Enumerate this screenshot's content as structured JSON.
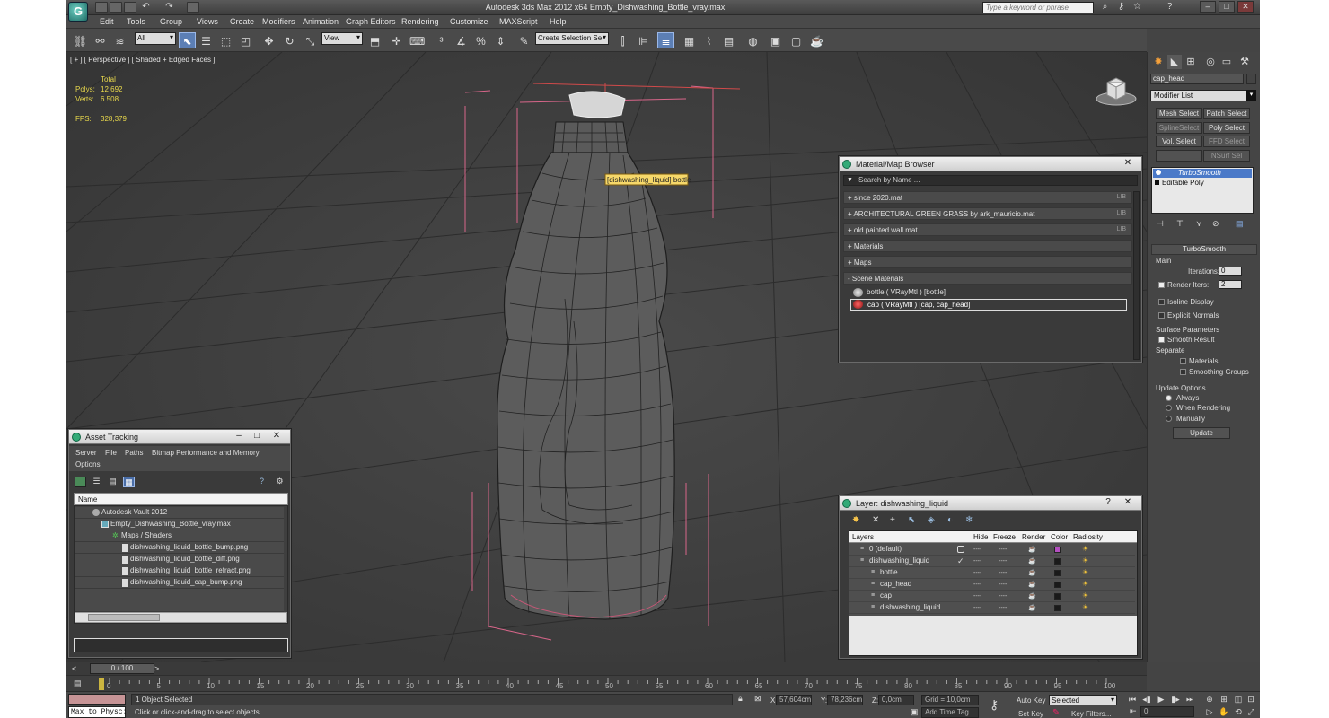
{
  "window": {
    "title": "Autodesk 3ds Max  2012 x64     Empty_Dishwashing_Bottle_vray.max",
    "search_placeholder": "Type a keyword or phrase",
    "app_letter": "G"
  },
  "menu": [
    "Edit",
    "Tools",
    "Group",
    "Views",
    "Create",
    "Modifiers",
    "Animation",
    "Graph Editors",
    "Rendering",
    "Customize",
    "MAXScript",
    "Help"
  ],
  "toolbar": {
    "filter": "All",
    "ref_coord": "View",
    "selection_set": "Create Selection Se"
  },
  "viewport": {
    "label": "[ + ] [ Perspective ] [ Shaded + Edged Faces ]",
    "stats": {
      "total_label": "Total",
      "polys_label": "Polys:",
      "polys_value": "12 692",
      "verts_label": "Verts:",
      "verts_value": "6 508",
      "fps_label": "FPS:",
      "fps_value": "328,379"
    },
    "tooltip": "[dishwashing_liquid] bottle"
  },
  "command_panel": {
    "object_name": "cap_head",
    "modifier_list": "Modifier List",
    "modifier_buttons": [
      [
        "Mesh Select",
        "Patch Select"
      ],
      [
        "SplineSelect",
        "Poly Select"
      ],
      [
        "Vol. Select",
        "FFD Select"
      ],
      [
        "",
        "NSurf Sel"
      ]
    ],
    "stack": [
      "TurboSmooth",
      "Editable Poly"
    ],
    "rollout_title": "TurboSmooth",
    "main_label": "Main",
    "iterations_label": "Iterations:",
    "iterations_value": "0",
    "render_iters_label": "Render Iters:",
    "render_iters_value": "2",
    "isoline_label": "Isoline Display",
    "explicit_label": "Explicit Normals",
    "surface_label": "Surface Parameters",
    "smooth_label": "Smooth Result",
    "separate_label": "Separate",
    "materials_label": "Materials",
    "smoothing_label": "Smoothing Groups",
    "update_options_label": "Update Options",
    "always_label": "Always",
    "when_rendering_label": "When Rendering",
    "manually_label": "Manually",
    "update_button": "Update"
  },
  "material_browser": {
    "title": "Material/Map Browser",
    "search_placeholder": "Search by Name ...",
    "groups": [
      {
        "label": "+ since 2020.mat",
        "lib": "LIB"
      },
      {
        "label": "+ ARCHITECTURAL GREEN GRASS by ark_mauricio.mat",
        "lib": "LIB"
      },
      {
        "label": "+ old painted wall.mat",
        "lib": "LIB"
      },
      {
        "label": "+ Materials",
        "lib": ""
      },
      {
        "label": "+ Maps",
        "lib": ""
      },
      {
        "label": "- Scene Materials",
        "lib": ""
      }
    ],
    "scene_materials": [
      "bottle  ( VRayMtl )  [bottle]",
      "cap  ( VRayMtl )  [cap, cap_head]"
    ]
  },
  "asset_tracking": {
    "title": "Asset Tracking",
    "menu": [
      "Server",
      "File",
      "Paths",
      "Bitmap Performance and Memory"
    ],
    "menu2": "Options",
    "column": "Name",
    "rows": [
      "Autodesk Vault 2012",
      "Empty_Dishwashing_Bottle_vray.max",
      "Maps / Shaders",
      "dishwashing_liquid_bottle_bump.png",
      "dishwashing_liquid_bottle_diff.png",
      "dishwashing_liquid_bottle_refract.png",
      "dishwashing_liquid_cap_bump.png"
    ]
  },
  "layer_panel": {
    "title": "Layer: dishwashing_liquid",
    "columns": [
      "Layers",
      "Hide",
      "Freeze",
      "Render",
      "Color",
      "Radiosity"
    ],
    "rows": [
      {
        "name": "0 (default)",
        "color": "#b44fc0"
      },
      {
        "name": "dishwashing_liquid",
        "color": "#1a1a1a"
      },
      {
        "name": "bottle",
        "color": "#1a1a1a"
      },
      {
        "name": "cap_head",
        "color": "#1a1a1a"
      },
      {
        "name": "cap",
        "color": "#1a1a1a"
      },
      {
        "name": "dishwashing_liquid",
        "color": "#1a1a1a"
      }
    ]
  },
  "timeline": {
    "frame": "0 / 100",
    "ticks": [
      "0",
      "5",
      "10",
      "15",
      "20",
      "25",
      "30",
      "35",
      "40",
      "45",
      "50",
      "55",
      "60",
      "65",
      "70",
      "75",
      "80",
      "85",
      "90",
      "95",
      "100"
    ]
  },
  "status": {
    "maxscript": "Max to Physc:",
    "selected": "1 Object Selected",
    "prompt": "Click or click-and-drag to select objects",
    "x_label": "X:",
    "x_value": "57,604cm",
    "y_label": "Y:",
    "y_value": "78,236cm",
    "z_label": "Z:",
    "z_value": "0,0cm",
    "grid": "Grid = 10,0cm",
    "auto_key": "Auto Key",
    "set_key": "Set Key",
    "key_mode": "Selected",
    "key_filters": "Key Filters...",
    "add_time_tag": "Add Time Tag",
    "frame_field": "0"
  }
}
